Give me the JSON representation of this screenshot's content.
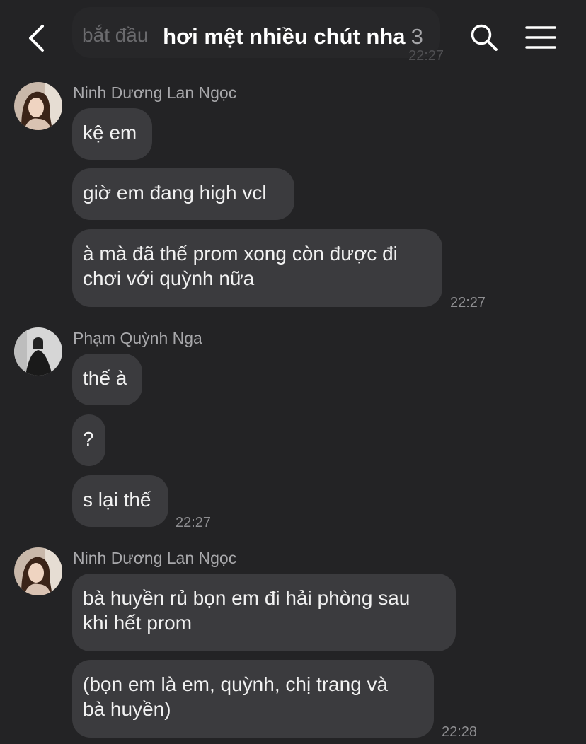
{
  "header": {
    "title": "hơi mệt nhiều chút nha",
    "member_count": "3",
    "ghost_text": "bắt đầu",
    "ghost_time": "22:27",
    "icons": {
      "back": "back-chevron-icon",
      "search": "search-icon",
      "menu": "hamburger-menu-icon"
    }
  },
  "groups": [
    {
      "sender": "Ninh Dương Lan Ngọc",
      "avatar": "avatar-ninh-duong-lan-ngoc",
      "messages": [
        {
          "text": "kệ em"
        },
        {
          "text": "giờ em đang high vcl"
        },
        {
          "text": "à mà đã thế prom xong còn được đi\nchơi với quỳnh nữa"
        }
      ],
      "time": "22:27"
    },
    {
      "sender": "Phạm Quỳnh Nga",
      "avatar": "avatar-pham-quynh-nga",
      "messages": [
        {
          "text": "thế à"
        },
        {
          "text": "?"
        },
        {
          "text": "s lại thế"
        }
      ],
      "time": "22:27"
    },
    {
      "sender": "Ninh Dương Lan Ngọc",
      "avatar": "avatar-ninh-duong-lan-ngoc",
      "messages": [
        {
          "text": "bà huyền rủ bọn em đi hải phòng sau\nkhi hết prom"
        },
        {
          "text": "(bọn em là em, quỳnh, chị trang và\nbà huyền)"
        }
      ],
      "time": "22:28"
    }
  ],
  "colors": {
    "background": "#232325",
    "bubble": "#3b3b3e",
    "text": "#f1f1f1",
    "meta_text": "#a8a8ab"
  }
}
